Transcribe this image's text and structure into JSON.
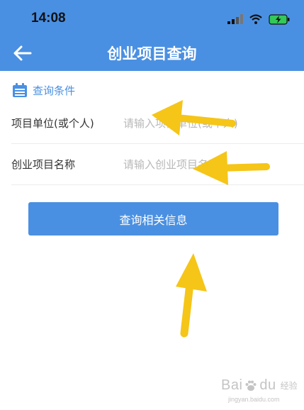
{
  "status_bar": {
    "time": "14:08"
  },
  "nav": {
    "title": "创业项目查询"
  },
  "section": {
    "title": "查询条件"
  },
  "form": {
    "fields": [
      {
        "label": "项目单位(或个人)",
        "placeholder": "请输入项目单位(或个人)"
      },
      {
        "label": "创业项目名称",
        "placeholder": "请输入创业项目名称"
      }
    ]
  },
  "actions": {
    "query_label": "查询相关信息"
  },
  "watermark": {
    "brand": "Bai",
    "brand_tail": "du",
    "suffix": "经验",
    "url": "jingyan.baidu.com"
  },
  "colors": {
    "primary": "#4a90e2",
    "annotation_arrow": "#f5c518"
  }
}
